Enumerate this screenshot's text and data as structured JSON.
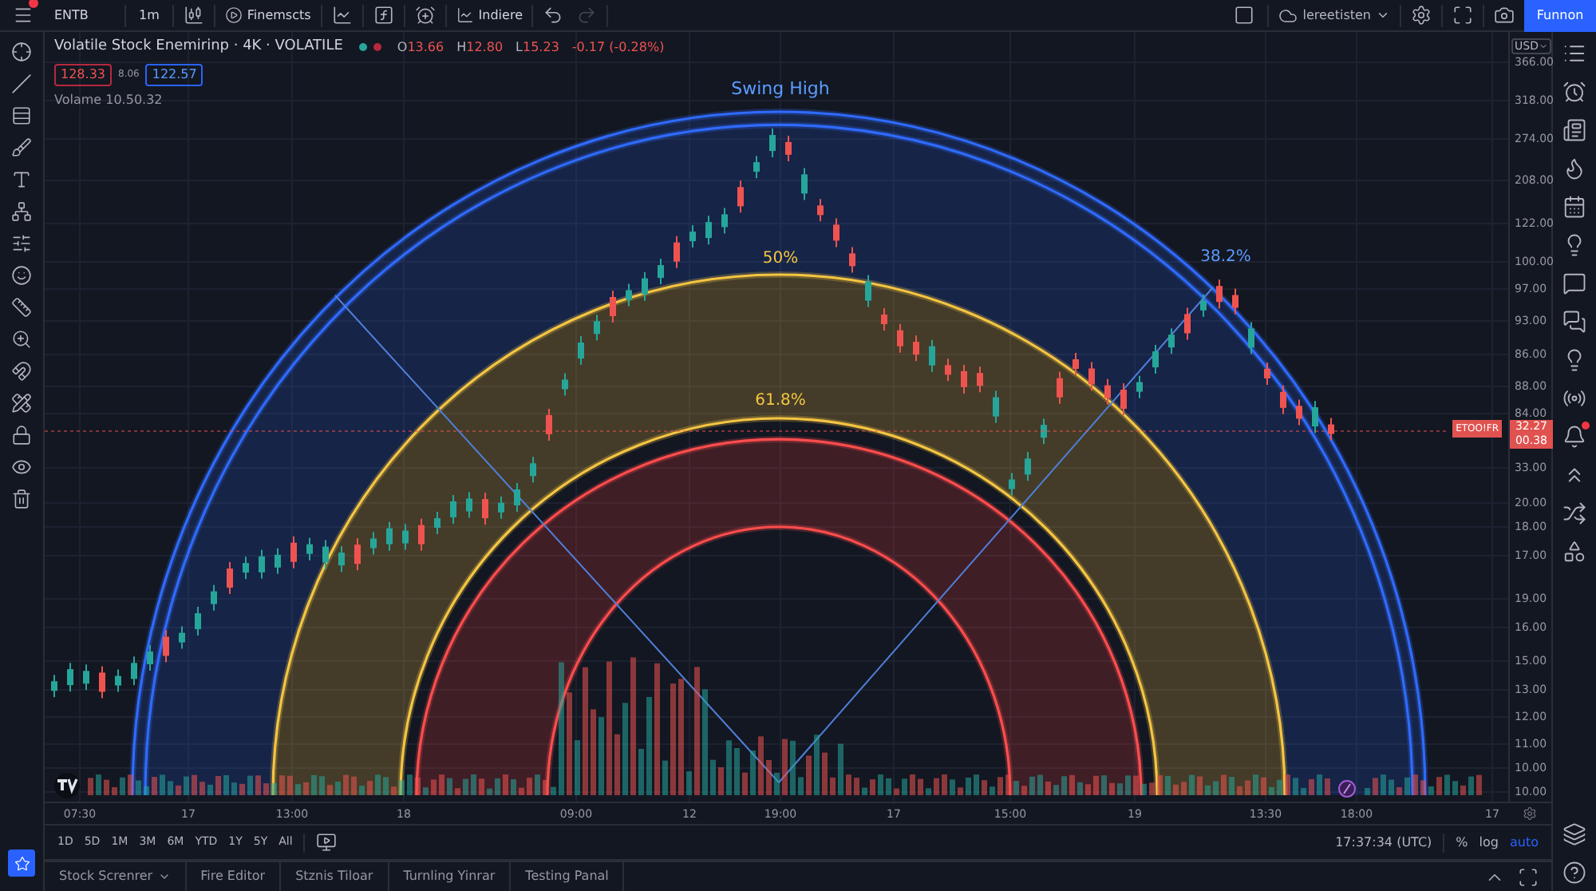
{
  "toolbar": {
    "symbol": "ENTB",
    "interval": "1m",
    "replay": "Finemscts",
    "indicators": "Indiere",
    "layout": "lereetisten",
    "publish": "Funnon"
  },
  "legend": {
    "title": "Volatile Stock Enemirinp · 4K · VOLATILE",
    "dots": [
      {
        "color": "#26a69a"
      },
      {
        "color": "#b7283f"
      }
    ],
    "ohlc": [
      {
        "label": "O",
        "value": "13.66"
      },
      {
        "label": "H",
        "value": "12.80"
      },
      {
        "label": "L",
        "value": "15.23"
      }
    ],
    "change": "-0.17 (-0.28%)",
    "sell": "128.33",
    "spread": "8.06",
    "buy": "122.57",
    "volume": "Volame 10.50.32"
  },
  "chart": {
    "labels": [
      {
        "kind": "swing",
        "text": "Swing High",
        "color": "#5b9cff"
      },
      {
        "kind": "level",
        "text": "50%",
        "color": "#f5c542"
      },
      {
        "kind": "level",
        "text": "61.8%",
        "color": "#f5c542"
      },
      {
        "kind": "level",
        "text": "38.2%",
        "color": "#5b9cff"
      }
    ],
    "price_tag": {
      "symbol": "ETOO!FR",
      "price": "32.27",
      "countdown": "00.38"
    }
  },
  "price_axis": {
    "currency": "USD",
    "labels": [
      "366.00",
      "318.00",
      "274.00",
      "208.00",
      "122.00",
      "100.00",
      "97.00",
      "93.00",
      "86.00",
      "88.00",
      "84.00",
      "33.00",
      "20.00",
      "18.00",
      "17.00",
      "19.00",
      "16.00",
      "15.00",
      "13.00",
      "12.00",
      "11.00",
      "10.00",
      "10.00"
    ]
  },
  "time_axis": {
    "labels": [
      "07:30",
      "17",
      "13:00",
      "18",
      "09:00",
      "12",
      "19:00",
      "17",
      "15:00",
      "19",
      "13:30",
      "18:00",
      "17"
    ]
  },
  "range_bar": {
    "ranges": [
      "1D",
      "5D",
      "1M",
      "3M",
      "6M",
      "YTD",
      "1Y",
      "5Y",
      "All"
    ],
    "time": "17:37:34 (UTC)",
    "scale_options": [
      {
        "label": "%",
        "selected": false
      },
      {
        "label": "log",
        "selected": false
      },
      {
        "label": "auto",
        "selected": true
      }
    ]
  },
  "bottom_tabs": [
    {
      "label": "Stock Screnrer",
      "dropdown": true
    },
    {
      "label": "Fire Editor",
      "dropdown": false
    },
    {
      "label": "Stznis Tiloar",
      "dropdown": false
    },
    {
      "label": "Turnling Yinrar",
      "dropdown": false
    },
    {
      "label": "Testing Panal",
      "dropdown": false
    }
  ]
}
